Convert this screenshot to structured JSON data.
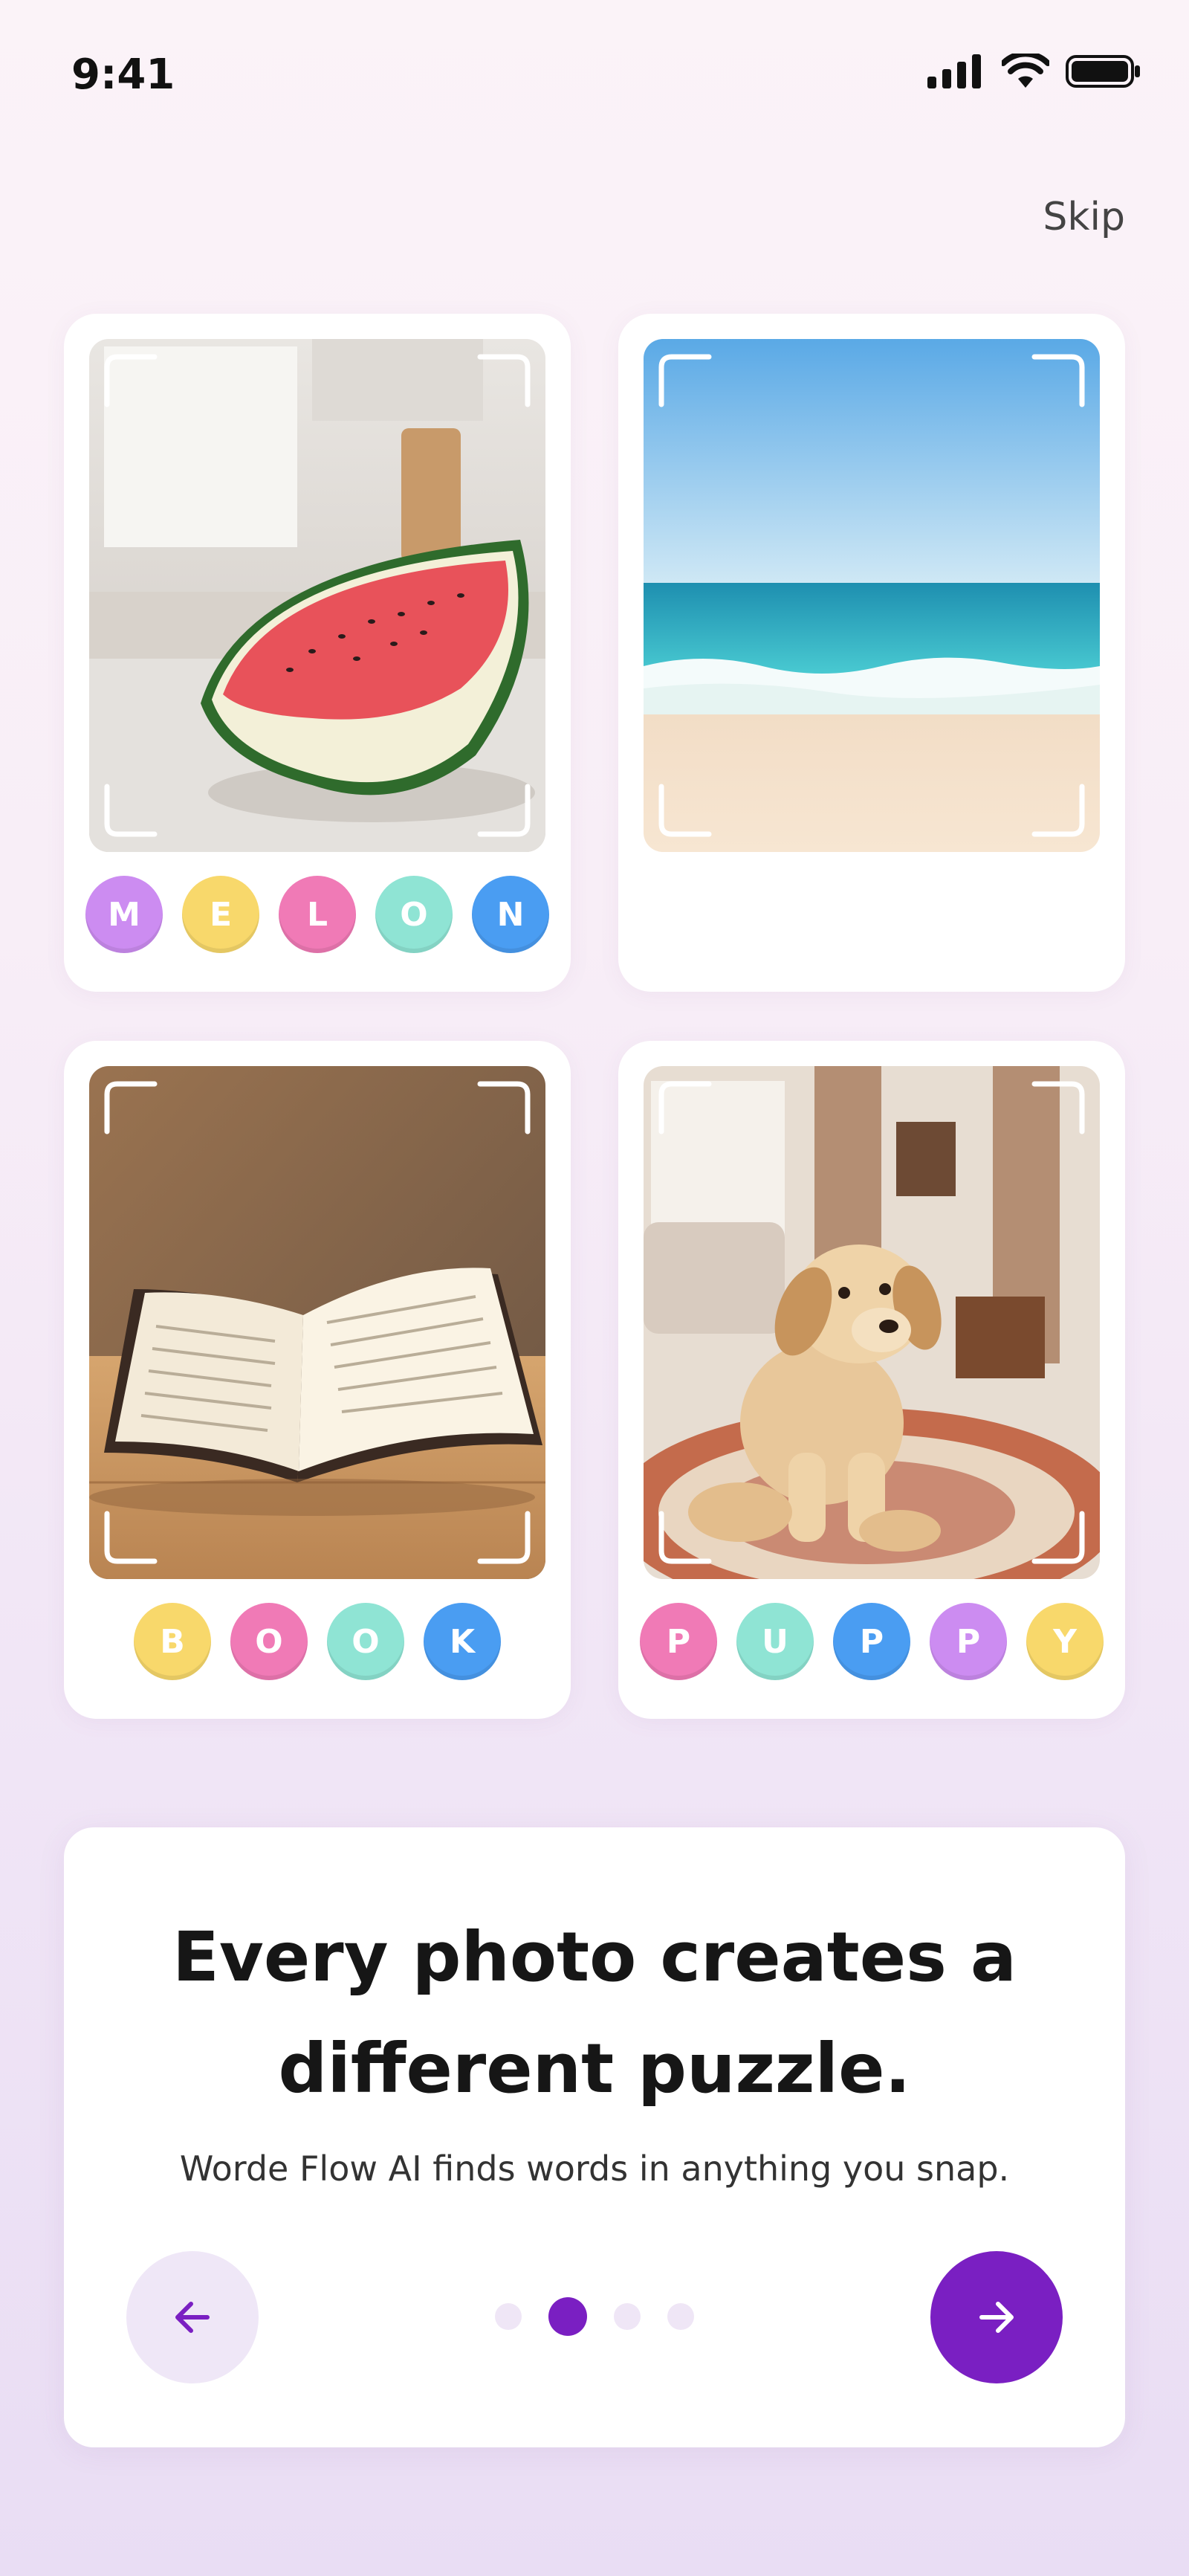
{
  "status": {
    "time": "9:41",
    "icons": [
      "signal-icon",
      "wifi-icon",
      "battery-icon"
    ]
  },
  "header": {
    "skip_label": "Skip"
  },
  "cards": [
    {
      "photo": "watermelon-photo",
      "letters": [
        "M",
        "E",
        "L",
        "O",
        "N"
      ],
      "letter_colors": [
        "#cc8cf1",
        "#f8d86b",
        "#f07ab6",
        "#8fe4d4",
        "#4a9df2"
      ]
    },
    {
      "photo": "beach-photo",
      "letters": [],
      "letter_colors": []
    },
    {
      "photo": "book-photo",
      "letters": [
        "B",
        "O",
        "O",
        "K"
      ],
      "letter_colors": [
        "#f8d86b",
        "#f07ab6",
        "#8fe4d4",
        "#4a9df2"
      ]
    },
    {
      "photo": "puppy-photo",
      "letters": [
        "P",
        "U",
        "P",
        "P",
        "Y"
      ],
      "letter_colors": [
        "#f07ab6",
        "#8fe4d4",
        "#4a9df2",
        "#cc8cf1",
        "#f8d86b"
      ]
    }
  ],
  "panel": {
    "headline": "Every photo creates a different puzzle.",
    "subtitle": "Worde Flow AI finds words in anything you snap.",
    "pagination": {
      "total": 4,
      "current": 2
    },
    "prev_icon": "arrow-left-icon",
    "next_icon": "arrow-right-icon"
  },
  "colors": {
    "accent": "#7a1fc2",
    "accent_light": "#efe7f7"
  }
}
